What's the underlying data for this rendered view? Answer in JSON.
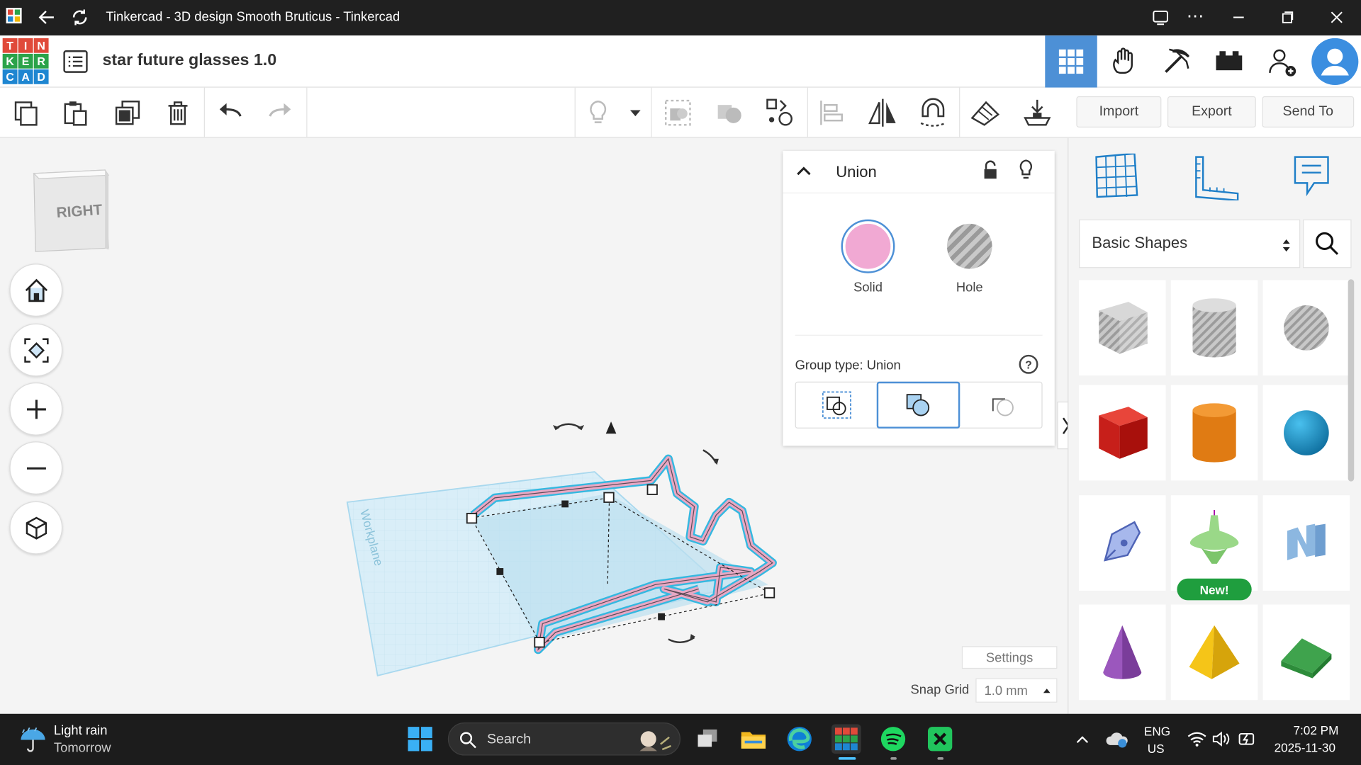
{
  "window": {
    "title": "Tinkercad - 3D design Smooth Bruticus - Tinkercad"
  },
  "logo": {
    "letters": [
      "T",
      "I",
      "N",
      "K",
      "E",
      "R",
      "C",
      "A",
      "D"
    ]
  },
  "header": {
    "project_title": "star future glasses 1.0"
  },
  "actions": {
    "import": "Import",
    "export": "Export",
    "send_to": "Send To"
  },
  "viewcube": {
    "face": "RIGHT"
  },
  "workplane": {
    "label": "Workplane"
  },
  "inspector": {
    "title": "Union",
    "solid_label": "Solid",
    "hole_label": "Hole",
    "group_type": "Group type: Union",
    "help": "?",
    "solid_color": "#f1a9d3"
  },
  "shapes_panel": {
    "category": "Basic Shapes",
    "new_badge": "New!"
  },
  "bottom": {
    "settings": "Settings",
    "snap_grid_label": "Snap Grid",
    "snap_grid_value": "1.0 mm"
  },
  "taskbar": {
    "weather_line1": "Light rain",
    "weather_line2": "Tomorrow",
    "search": "Search",
    "lang1": "ENG",
    "lang2": "US",
    "time": "7:02 PM",
    "date": "2025-11-30"
  },
  "colors": {
    "accent": "#4d90d6",
    "selection": "#34b8e0"
  }
}
